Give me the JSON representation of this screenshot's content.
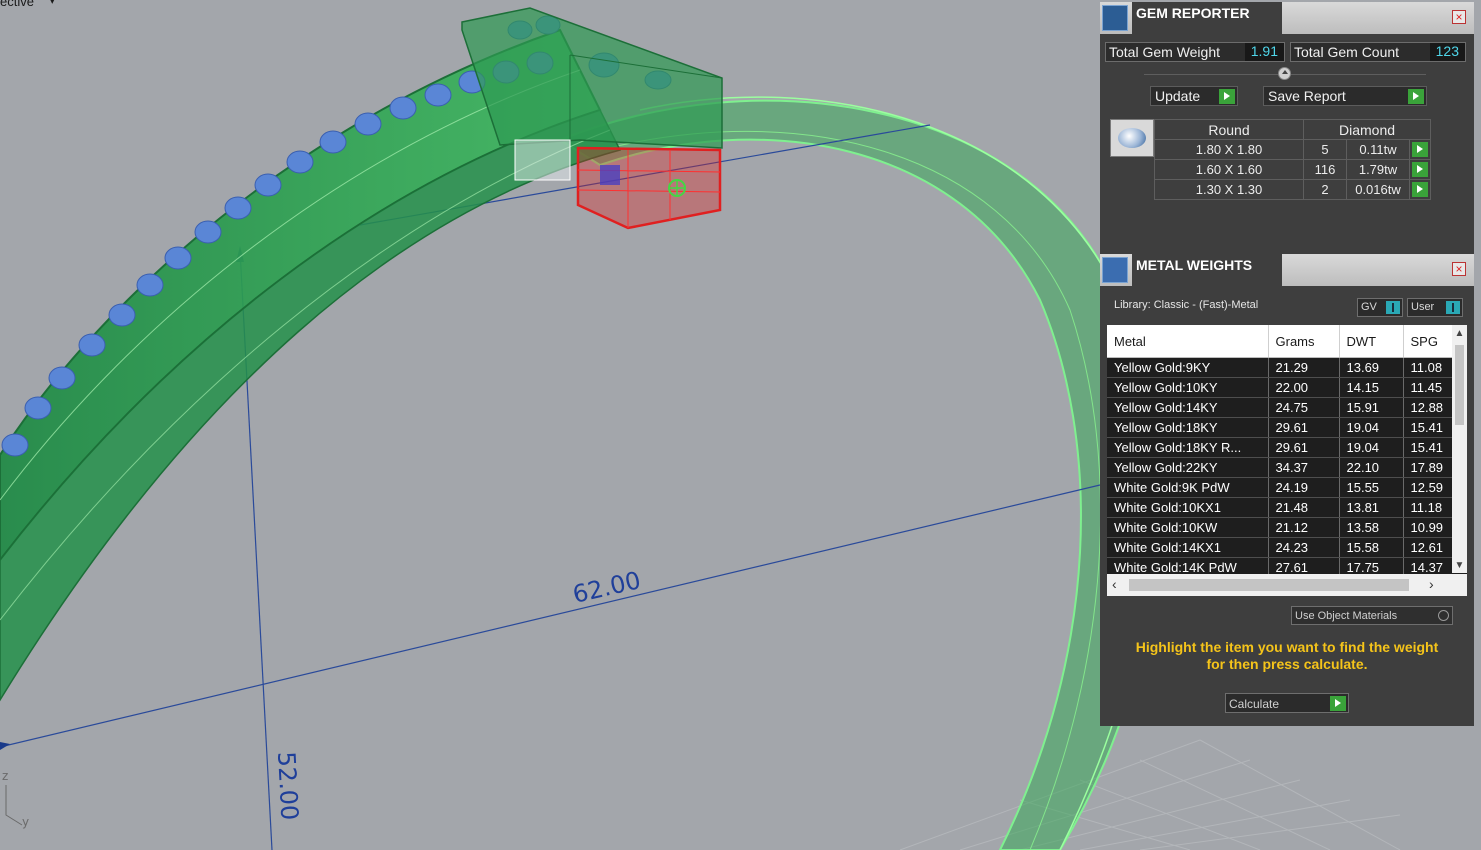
{
  "viewport": {
    "label": "ective",
    "dim_width": "62.00",
    "dim_height": "52.00",
    "axis_z": "z",
    "axis_y": "y"
  },
  "gem_reporter": {
    "title": "GEM REPORTER",
    "total_weight_label": "Total Gem Weight",
    "total_weight_value": "1.91",
    "total_count_label": "Total Gem Count",
    "total_count_value": "123",
    "update_label": "Update",
    "save_label": "Save Report",
    "shape_header": "Round",
    "material_header": "Diamond",
    "rows": [
      {
        "size": "1.80 X 1.80",
        "count": "5",
        "weight": "0.11tw"
      },
      {
        "size": "1.60 X 1.60",
        "count": "116",
        "weight": "1.79tw"
      },
      {
        "size": "1.30 X 1.30",
        "count": "2",
        "weight": "0.016tw"
      }
    ]
  },
  "metal_weights": {
    "title": "METAL WEIGHTS",
    "library": "Library: Classic - (Fast)-Metal",
    "toggle_gv": "GV",
    "toggle_user": "User",
    "columns": [
      "Metal",
      "Grams",
      "DWT",
      "SPG"
    ],
    "rows": [
      {
        "metal": "Yellow Gold:9KY",
        "grams": "21.29",
        "dwt": "13.69",
        "spg": "11.08"
      },
      {
        "metal": "Yellow Gold:10KY",
        "grams": "22.00",
        "dwt": "14.15",
        "spg": "11.45"
      },
      {
        "metal": "Yellow Gold:14KY",
        "grams": "24.75",
        "dwt": "15.91",
        "spg": "12.88"
      },
      {
        "metal": "Yellow Gold:18KY",
        "grams": "29.61",
        "dwt": "19.04",
        "spg": "15.41"
      },
      {
        "metal": "Yellow Gold:18KY R...",
        "grams": "29.61",
        "dwt": "19.04",
        "spg": "15.41"
      },
      {
        "metal": "Yellow Gold:22KY",
        "grams": "34.37",
        "dwt": "22.10",
        "spg": "17.89"
      },
      {
        "metal": "White Gold:9K PdW",
        "grams": "24.19",
        "dwt": "15.55",
        "spg": "12.59"
      },
      {
        "metal": "White Gold:10KX1",
        "grams": "21.48",
        "dwt": "13.81",
        "spg": "11.18"
      },
      {
        "metal": "White Gold:10KW",
        "grams": "21.12",
        "dwt": "13.58",
        "spg": "10.99"
      },
      {
        "metal": "White Gold:14KX1",
        "grams": "24.23",
        "dwt": "15.58",
        "spg": "12.61"
      },
      {
        "metal": "White Gold:14K PdW",
        "grams": "27.61",
        "dwt": "17.75",
        "spg": "14.37"
      }
    ],
    "use_object_materials": "Use Object Materials",
    "hint_line1": "Highlight the item you want to find the weight",
    "hint_line2": "for then press calculate.",
    "calculate_label": "Calculate"
  },
  "colors": {
    "viewport_bg": "#a3a6ab",
    "ring_green": "#2e9a52",
    "gem_blue": "#5a86d6",
    "selection_red": "#e02020",
    "dimension_blue": "#2a4a9a",
    "panel_bg": "#3e3e3e",
    "value_cyan": "#4fd6ea",
    "hint_yellow": "#f5c41a"
  }
}
